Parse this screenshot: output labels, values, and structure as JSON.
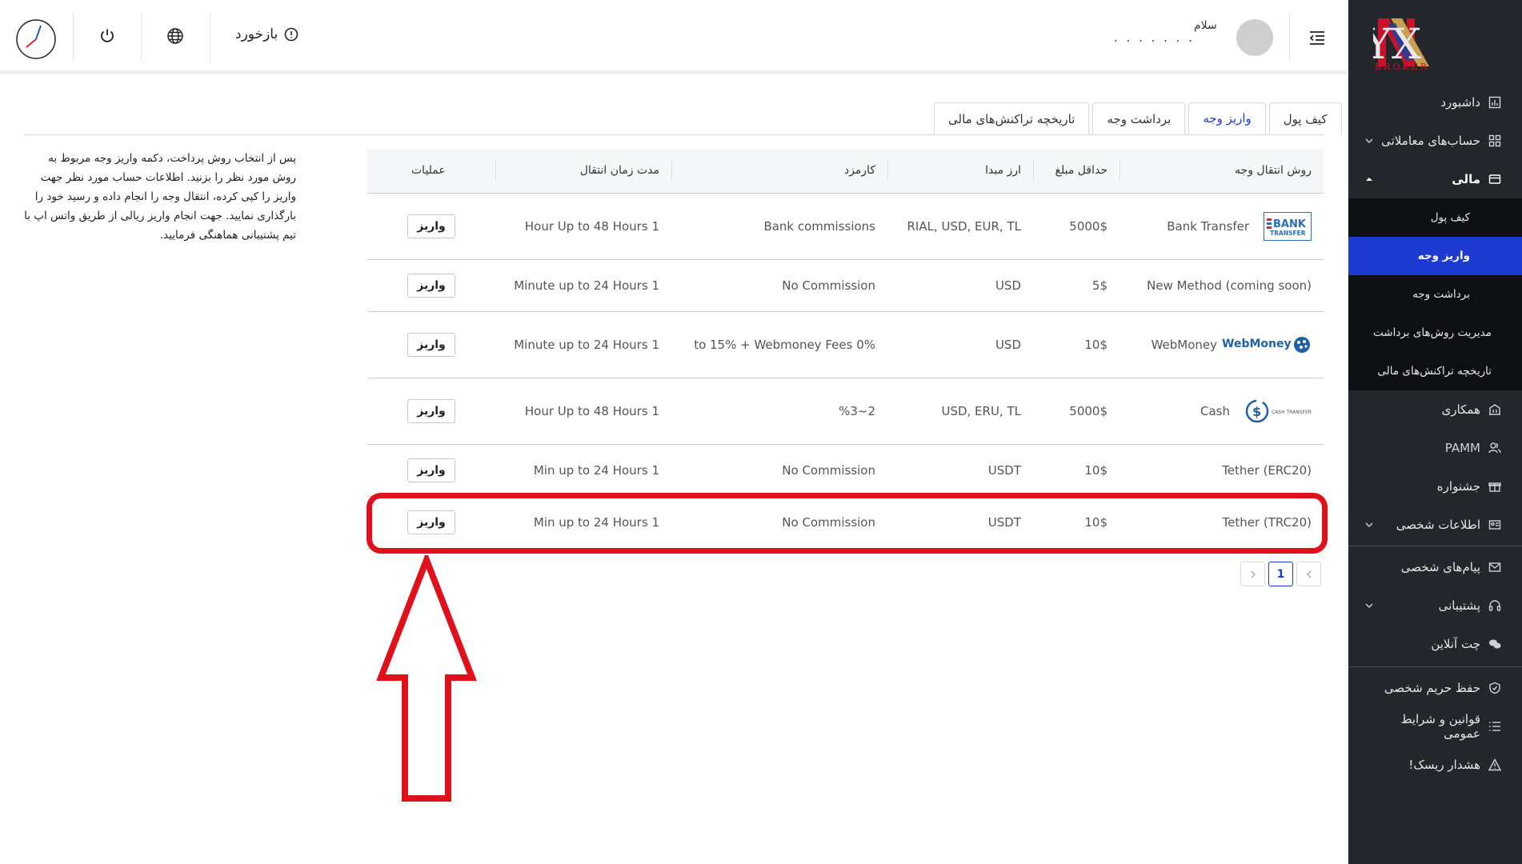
{
  "sidebar": {
    "logo_text": "NYX BROKER",
    "items_top": [
      {
        "label": "داشبورد",
        "icon": "chart-icon"
      },
      {
        "label": "حساب‌های معاملاتی",
        "icon": "grid-icon"
      },
      {
        "label": "مالی",
        "icon": "wallet-icon"
      }
    ],
    "finance_submenu": [
      {
        "label": "کیف پول",
        "active": false
      },
      {
        "label": "واریز وجه",
        "active": true
      },
      {
        "label": "برداشت وجه",
        "active": false
      },
      {
        "label": "مدیریت روش‌های برداشت",
        "active": false
      },
      {
        "label": "تاریخچه تراکنش‌های مالی",
        "active": false
      }
    ],
    "items_mid": [
      {
        "label": "همکاری",
        "icon": "building-icon"
      },
      {
        "label": "PAMM",
        "icon": "users-icon"
      },
      {
        "label": "جشنواره",
        "icon": "gift-icon"
      },
      {
        "label": "اطلاعات شخصی",
        "icon": "id-card-icon"
      }
    ],
    "items_support": [
      {
        "label": "پیام‌های شخصی",
        "icon": "mail-icon"
      },
      {
        "label": "پشتیبانی",
        "icon": "headset-icon"
      },
      {
        "label": "چت آنلاین",
        "icon": "chat-icon"
      }
    ],
    "items_bottom": [
      {
        "label": "حفظ حریم شخصی",
        "icon": "shield-icon"
      },
      {
        "label": "قوانین و شرایط عمومی",
        "icon": "list-icon"
      },
      {
        "label": "هشدار ریسک!",
        "icon": "warning-icon"
      }
    ]
  },
  "topbar": {
    "feedback_label": "بازخورد",
    "greeting": "سلام",
    "username_masked": ". . . .   . . ."
  },
  "tabs": [
    "کیف پول",
    "واریز وجه",
    "برداشت وجه",
    "تاریخچه تراکنش‌های مالی"
  ],
  "active_tab": "واریز وجه",
  "info_text": "پس از انتخاب روش پرداخت، دکمه واریز وجه مربوط به روش مورد نظر را بزنید. اطلاعات حساب مورد نظر جهت واریز را کپی کرده، انتقال وجه را انجام داده و رسید خود را بارگذاری نمایید. جهت انجام واریز ریالی از طریق واتس اپ با تیم پشتیبانی هماهنگی فرمایید.",
  "table": {
    "headers": [
      "روش انتقال وجه",
      "حداقل مبلغ",
      "ارز مبدا",
      "کارمزد",
      "مدت زمان انتقال",
      "عملیات"
    ],
    "rows": [
      {
        "method": "Bank Transfer",
        "logo": "bank-transfer-logo",
        "min": "5000$",
        "currency": "RIAL, USD, EUR, TL",
        "fee": "Bank commissions",
        "time": "1 Hour Up to 48 Hours",
        "action": "واریز"
      },
      {
        "method": "New Method (coming soon)",
        "logo": "",
        "min": "5$",
        "currency": "USD",
        "fee": "No Commission",
        "time": "1 Minute up to 24 Hours",
        "action": "واریز"
      },
      {
        "method": "WebMoney",
        "logo": "webmoney-logo",
        "min": "10$",
        "currency": "USD",
        "fee": "0% to 15% + Webmoney Fees",
        "time": "1 Minute up to 24 Hours",
        "action": "واریز"
      },
      {
        "method": "Cash",
        "logo": "cash-transfer-logo",
        "min": "5000$",
        "currency": "USD, ERU, TL",
        "fee": "2~%3",
        "time": "1 Hour Up to 48 Hours",
        "action": "واریز"
      },
      {
        "method": "Tether (ERC20)",
        "logo": "",
        "min": "10$",
        "currency": "USDT",
        "fee": "No Commission",
        "time": "1 Min up to 24 Hours",
        "action": "واریز"
      },
      {
        "method": "Tether (TRC20)",
        "logo": "",
        "min": "10$",
        "currency": "USDT",
        "fee": "No Commission",
        "time": "1 Min up to 24 Hours",
        "action": "واریز"
      }
    ]
  },
  "logo_texts": {
    "bank": "BANK",
    "bank_sub": "TRANSFER",
    "webmoney": "WebMoney",
    "cash_sub": "CASH TRANSFER"
  },
  "pagination": {
    "current_page": "1"
  },
  "annotation": {
    "highlight_color": "#e0111b",
    "highlighted_row": "Tether (TRC20)"
  },
  "colors": {
    "sidebar_bg": "#23272c",
    "submenu_bg": "#0d0f12",
    "accent": "#1d3bd1"
  }
}
